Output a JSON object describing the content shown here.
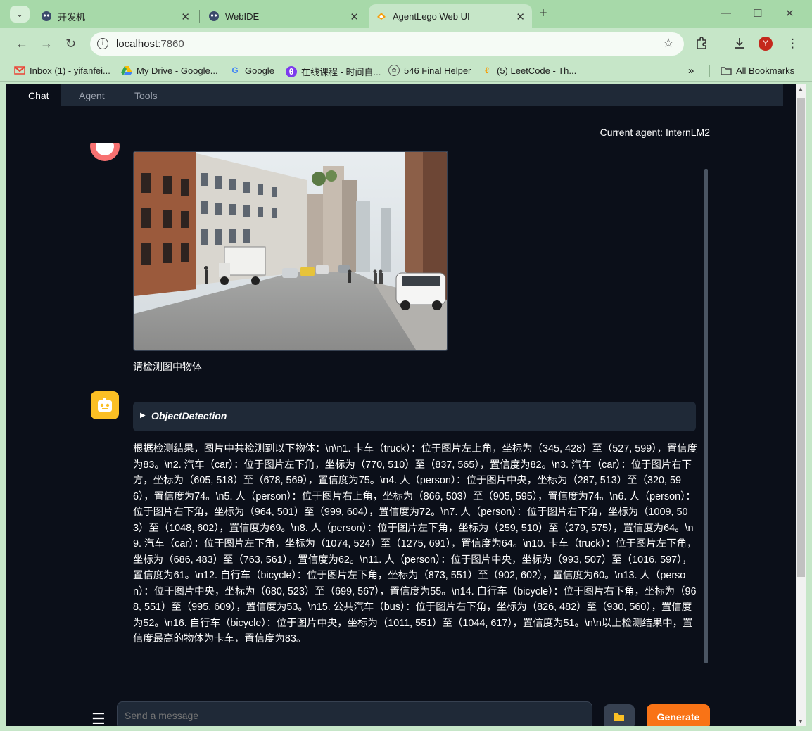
{
  "browser": {
    "tabs": [
      {
        "title": "开发机"
      },
      {
        "title": "WebIDE"
      },
      {
        "title": "AgentLego Web UI"
      }
    ],
    "url_host": "localhost",
    "url_port": ":7860",
    "profile_initial": "Y",
    "bookmarks": [
      {
        "label": "Inbox (1) - yifanfei..."
      },
      {
        "label": "My Drive - Google..."
      },
      {
        "label": "Google"
      },
      {
        "label": "在线课程 - 时间自..."
      },
      {
        "label": "546 Final Helper"
      },
      {
        "label": "(5) LeetCode - Th..."
      }
    ],
    "all_bookmarks": "All Bookmarks"
  },
  "app": {
    "tabs": [
      "Chat",
      "Agent",
      "Tools"
    ],
    "current_agent": "Current agent: InternLM2",
    "user_message": "请检测图中物体",
    "tool_name": "ObjectDetection",
    "bot_reply": "根据检测结果，图片中共检测到以下物体：\\n\\n1. 卡车（truck）：位于图片左上角，坐标为（345, 428）至（527, 599），置信度为83。\\n2. 汽车（car）：位于图片左下角，坐标为（770, 510）至（837, 565），置信度为82。\\n3. 汽车（car）：位于图片右下方，坐标为（605, 518）至（678, 569），置信度为75。\\n4. 人（person）：位于图片中央，坐标为（287, 513）至（320, 596），置信度为74。\\n5. 人（person）：位于图片右上角，坐标为（866, 503）至（905, 595），置信度为74。\\n6. 人（person）：位于图片右下角，坐标为（964, 501）至（999, 604），置信度为72。\\n7. 人（person）：位于图片右下角，坐标为（1009, 503）至（1048, 602），置信度为69。\\n8. 人（person）：位于图片左下角，坐标为（259, 510）至（279, 575），置信度为64。\\n9. 汽车（car）：位于图片左下角，坐标为（1074, 524）至（1275, 691），置信度为64。\\n10. 卡车（truck）：位于图片左下角，坐标为（686, 483）至（763, 561），置信度为62。\\n11. 人（person）：位于图片中央，坐标为（993, 507）至（1016, 597），置信度为61。\\n12. 自行车（bicycle）：位于图片左下角，坐标为（873, 551）至（902, 602），置信度为60。\\n13. 人（person）：位于图片中央，坐标为（680, 523）至（699, 567），置信度为55。\\n14. 自行车（bicycle）：位于图片右下角，坐标为（968, 551）至（995, 609），置信度为53。\\n15. 公共汽车（bus）：位于图片右下角，坐标为（826, 482）至（930, 560），置信度为52。\\n16. 自行车（bicycle）：位于图片中央，坐标为（1011, 551）至（1044, 617），置信度为51。\\n\\n以上检测结果中，置信度最高的物体为卡车，置信度为83。",
    "input_placeholder": "Send a message",
    "generate_label": "Generate"
  }
}
